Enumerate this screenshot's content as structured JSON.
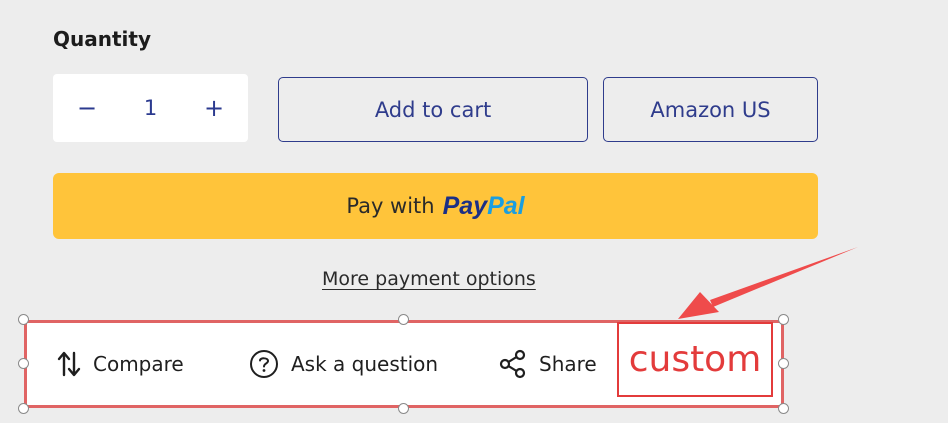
{
  "quantity": {
    "label": "Quantity",
    "decrement": "−",
    "value": "1",
    "increment": "+"
  },
  "buttons": {
    "add_to_cart": "Add to cart",
    "amazon": "Amazon US",
    "pay_with": "Pay with",
    "paypal_pay": "Pay",
    "paypal_pal": "Pal",
    "more_options": "More payment options"
  },
  "actions": {
    "compare": "Compare",
    "ask": "Ask a question",
    "share": "Share",
    "custom": "custom"
  },
  "colors": {
    "accent": "#2f3c8c",
    "paypal_yellow": "#ffc43a",
    "annotation_red": "#e33b3b"
  }
}
